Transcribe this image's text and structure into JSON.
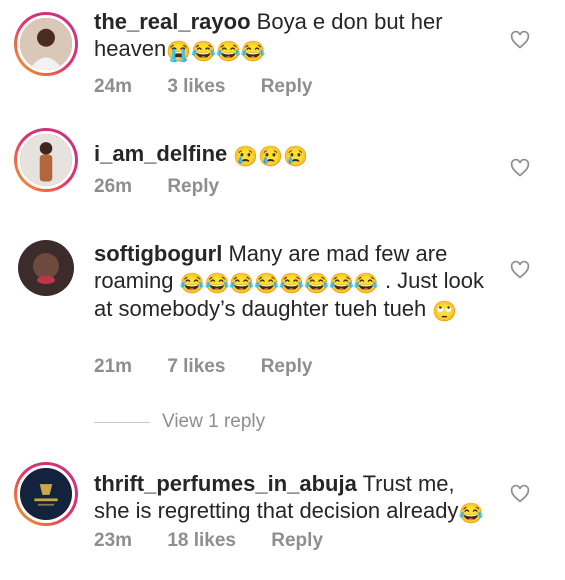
{
  "comments": [
    {
      "username": "the_real_rayoo",
      "text": "Boya e don but her heaven",
      "emojis": "😭😂😂😂",
      "time": "24m",
      "likes": "3 likes",
      "reply": "Reply"
    },
    {
      "username": "i_am_delfine",
      "text": "",
      "emojis": "😢😢😢",
      "time": "26m",
      "reply": "Reply"
    },
    {
      "username": "softigbogurl",
      "text_1": "Many are mad few are roaming",
      "emojis_1": "😂😂😂😂😂😂😂😂",
      "text_2": ". Just look at somebody’s daughter tueh tueh",
      "emojis_2": "🙄",
      "time": "21m",
      "likes": "7 likes",
      "reply": "Reply"
    },
    {
      "username": "thrift_perfumes_in_abuja",
      "text": "Trust me, she is regretting that decision already",
      "emojis": "😂",
      "time": "23m",
      "likes": "18 likes",
      "reply": "Reply"
    }
  ],
  "view_replies": "View 1 reply",
  "icons": {
    "like": "heart-outline-icon"
  },
  "colors": {
    "text": "#262626",
    "muted": "#8e8e8e",
    "story_ring": "#e1306c"
  }
}
